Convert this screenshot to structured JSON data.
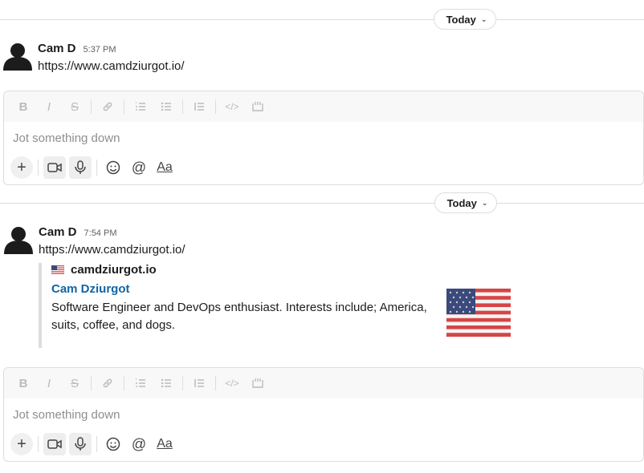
{
  "dividers": [
    {
      "label": "Today"
    },
    {
      "label": "Today"
    }
  ],
  "messages": [
    {
      "author": "Cam D",
      "time": "5:37 PM",
      "text": "https://www.camdziurgot.io/"
    },
    {
      "author": "Cam D",
      "time": "7:54 PM",
      "text": "https://www.camdziurgot.io/",
      "unfurl": {
        "site": "camdziurgot.io",
        "title": "Cam Dziurgot",
        "description": "Software Engineer and DevOps enthusiast. Interests include; America, suits, coffee, and dogs."
      }
    }
  ],
  "composer": {
    "placeholder": "Jot something down",
    "format_icons": [
      "bold-icon",
      "italic-icon",
      "strikethrough-icon",
      "link-icon",
      "ordered-list-icon",
      "bulleted-list-icon",
      "blockquote-icon",
      "code-icon",
      "code-block-icon"
    ],
    "action_icons": [
      "plus-icon",
      "video-icon",
      "microphone-icon",
      "emoji-icon",
      "mention-icon",
      "text-format-icon"
    ],
    "aa_label": "Aa"
  },
  "colors": {
    "link_title": "#1264a3",
    "flag_red": "#d64545",
    "flag_blue": "#3b4a7a"
  }
}
